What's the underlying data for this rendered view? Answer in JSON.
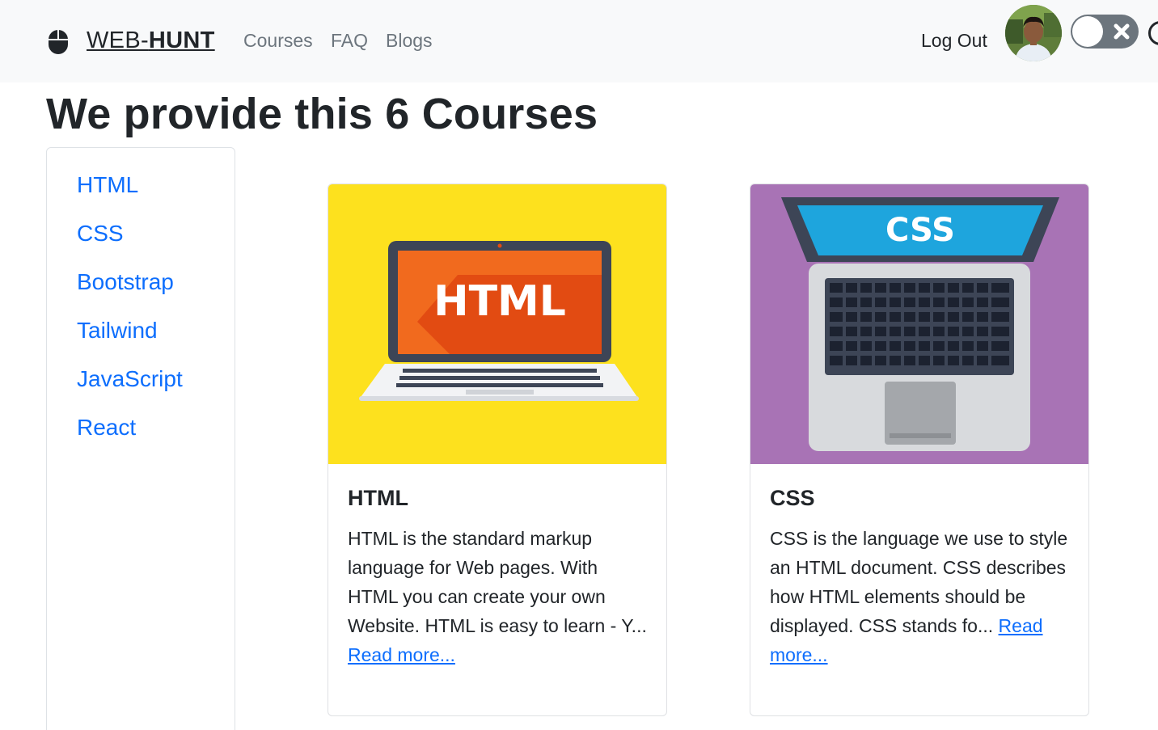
{
  "navbar": {
    "brand_prefix": "WEB-",
    "brand_bold": "HUNT",
    "brand_icon": "mouse-icon",
    "links": [
      "Courses",
      "FAQ",
      "Blogs"
    ],
    "logout_label": "Log Out",
    "theme_toggle_icon": "close-icon"
  },
  "page": {
    "title": "We provide this 6 Courses"
  },
  "sidebar": {
    "items": [
      "HTML",
      "CSS",
      "Bootstrap",
      "Tailwind",
      "JavaScript",
      "React"
    ]
  },
  "cards": [
    {
      "title": "HTML",
      "image_text": "HTML",
      "description": "HTML is the standard markup language for Web pages. With HTML you can create your own Website. HTML is easy to learn - Y...",
      "read_more": "Read more..."
    },
    {
      "title": "CSS",
      "image_text": "CSS",
      "description": "CSS is the language we use to style an HTML document. CSS describes how HTML elements should be displayed. CSS stands fo...",
      "read_more": "Read more..."
    }
  ],
  "colors": {
    "navbar_bg": "#f8f9fa",
    "link_blue": "#0d6efd",
    "muted": "#6c757d",
    "html_card_bg": "#fde11e",
    "css_card_bg": "#a873b5"
  }
}
